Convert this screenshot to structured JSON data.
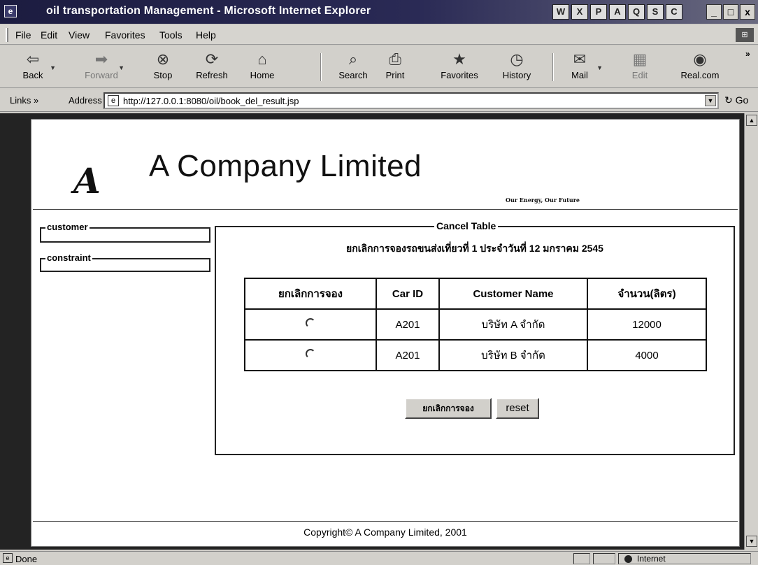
{
  "window": {
    "title": "oil transportation Management - Microsoft Internet Explorer",
    "controls": [
      "_",
      "□",
      "x"
    ],
    "quicklaunch": [
      "W",
      "X",
      "P",
      "A",
      "Q",
      "S",
      "C"
    ]
  },
  "menu": {
    "items": [
      "File",
      "Edit",
      "View",
      "Favorites",
      "Tools",
      "Help"
    ]
  },
  "toolbar": {
    "buttons": [
      {
        "label": "Back",
        "icon": "back-arrow-icon",
        "glyph": "⇦"
      },
      {
        "label": "Forward",
        "icon": "forward-arrow-icon",
        "glyph": "➡"
      },
      {
        "label": "Stop",
        "icon": "stop-icon",
        "glyph": "⊗"
      },
      {
        "label": "Refresh",
        "icon": "refresh-icon",
        "glyph": "⟳"
      },
      {
        "label": "Home",
        "icon": "home-icon",
        "glyph": "⌂"
      },
      {
        "label": "Search",
        "icon": "search-icon",
        "glyph": "⌕"
      },
      {
        "label": "Print",
        "icon": "print-icon",
        "glyph": "⎙"
      },
      {
        "label": "Favorites",
        "icon": "favorites-icon",
        "glyph": "★"
      },
      {
        "label": "History",
        "icon": "history-icon",
        "glyph": "◷"
      },
      {
        "label": "Mail",
        "icon": "mail-icon",
        "glyph": "✉"
      },
      {
        "label": "Edit",
        "icon": "edit-icon",
        "glyph": "▦"
      },
      {
        "label": "Real.com",
        "icon": "real-icon",
        "glyph": "◉"
      }
    ],
    "more": "»"
  },
  "address": {
    "links_label": "Links »",
    "address_label": "Address",
    "url": "http://127.0.0.1:8080/oil/book_del_result.jsp",
    "go_label": "Go"
  },
  "page": {
    "company": "A Company Limited",
    "logo_glyph": "A",
    "slogan": "Our Energy, Our Future",
    "sidebar": {
      "customer_legend": "customer",
      "constraint_legend": "constraint"
    },
    "cancel_table": {
      "legend": "Cancel Table",
      "subtitle": "ยกเลิกการจองรถขนส่งเที่ยวที่ 1 ประจำวันที่ 12 มกราคม 2545",
      "columns": [
        "ยกเลิกการจอง",
        "Car ID",
        "Customer Name",
        "จำนวน(ลิตร)"
      ],
      "rows": [
        {
          "car_id": "A201",
          "customer": "บริษัท A จำกัด",
          "amount": "12000"
        },
        {
          "car_id": "A201",
          "customer": "บริษัท B จำกัด",
          "amount": "4000"
        }
      ],
      "submit_label": "ยกเลิกการจอง",
      "reset_label": "reset"
    },
    "copyright": "Copyright© A Company Limited, 2001"
  },
  "status": {
    "text": "Done",
    "zone": "Internet"
  }
}
